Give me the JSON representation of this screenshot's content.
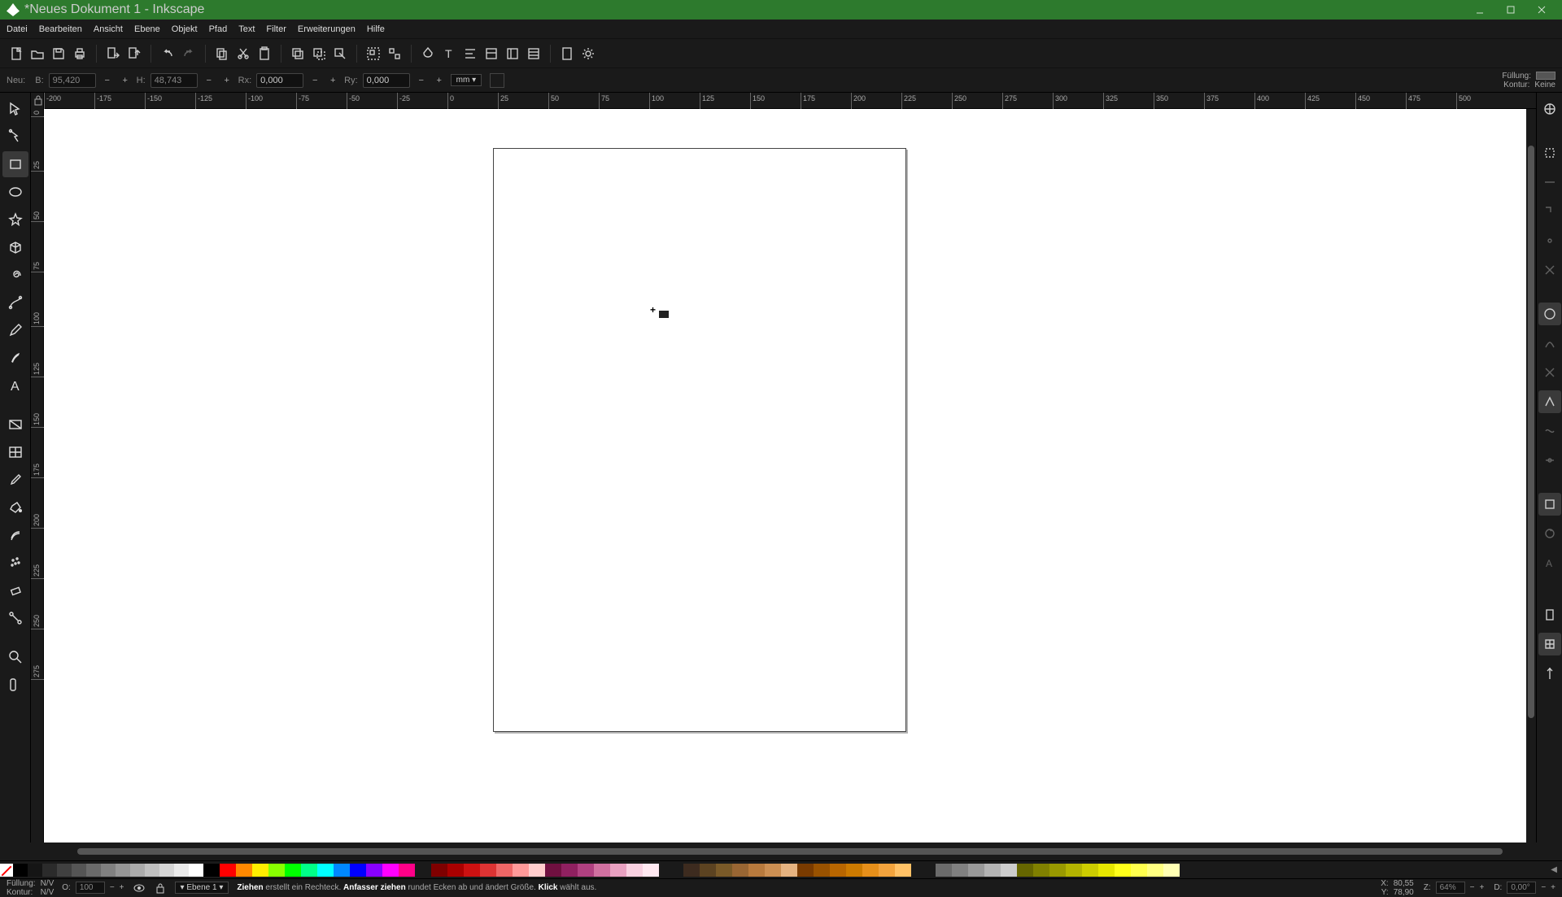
{
  "window": {
    "title": "*Neues Dokument 1 - Inkscape"
  },
  "menu": [
    "Datei",
    "Bearbeiten",
    "Ansicht",
    "Ebene",
    "Objekt",
    "Pfad",
    "Text",
    "Filter",
    "Erweiterungen",
    "Hilfe"
  ],
  "toolopts": {
    "neu": "Neu:",
    "b": "B:",
    "b_val": "95,420",
    "h": "H:",
    "h_val": "48,743",
    "rx": "Rx:",
    "rx_val": "0,000",
    "ry": "Ry:",
    "ry_val": "0,000",
    "unit": "mm",
    "fill_lbl": "Füllung:",
    "stroke_lbl": "Kontur:",
    "stroke_val": "Keine"
  },
  "ruler_h_ticks": [
    "-200",
    "-175",
    "-150",
    "-125",
    "-100",
    "-75",
    "-50",
    "-25",
    "0",
    "25",
    "50",
    "75",
    "100",
    "125",
    "150",
    "175",
    "200",
    "225",
    "250",
    "275",
    "300",
    "325",
    "350",
    "375",
    "400",
    "425",
    "450",
    "475",
    "500"
  ],
  "ruler_v_ticks": [
    "0",
    "25",
    "50",
    "75",
    "100",
    "125",
    "150",
    "175",
    "200",
    "225",
    "250",
    "275"
  ],
  "status": {
    "fill_lbl": "Füllung:",
    "fill_val": "N/V",
    "stroke_lbl": "Kontur:",
    "stroke_val": "N/V",
    "o_lbl": "O:",
    "o_val": "100",
    "layer": "Ebene 1",
    "hint_bold1": "Ziehen",
    "hint_1": " erstellt ein Rechteck. ",
    "hint_bold2": "Anfasser ziehen",
    "hint_2": " rundet Ecken ab und ändert Größe. ",
    "hint_bold3": "Klick",
    "hint_3": " wählt aus.",
    "x_lbl": "X:",
    "x_val": "80,55",
    "y_lbl": "Y:",
    "y_val": "78,90",
    "z_lbl": "Z:",
    "z_val": "64%",
    "d_lbl": "D:",
    "d_val": "0,00°"
  },
  "palette": {
    "grays": 12,
    "hues": [
      "#000",
      "#ff0000",
      "#ff8800",
      "#ffee00",
      "#88ff00",
      "#00ff00",
      "#00ff88",
      "#00ffff",
      "#0088ff",
      "#0000ff",
      "#8800ff",
      "#ff00ff",
      "#ff0088"
    ],
    "reds": [
      "#7f0000",
      "#a00",
      "#c11",
      "#d33",
      "#e66",
      "#f99",
      "#fcc"
    ],
    "pinks": [
      "#701040",
      "#902060",
      "#b04080",
      "#d070a0",
      "#e8a0c0",
      "#f8d0e0",
      "#ffe8f0"
    ],
    "browns": [
      "#3d2b1f",
      "#5c4321",
      "#7a5a28",
      "#996633",
      "#b87a3d",
      "#cc8f52",
      "#e6b380"
    ],
    "oranges": [
      "#7a3b00",
      "#995200",
      "#b86600",
      "#cc7a00",
      "#e68f1a",
      "#f2a33d",
      "#ffc166"
    ],
    "warmgray": [
      "#6b6b6b",
      "#808080",
      "#999",
      "#b3b3b3",
      "#ccc"
    ],
    "greens": [
      "#666600",
      "#808000",
      "#999900",
      "#b3b300",
      "#cccc00",
      "#e6e600",
      "#ffff1a",
      "#ffff4d",
      "#ffff80",
      "#ffffb3"
    ]
  }
}
